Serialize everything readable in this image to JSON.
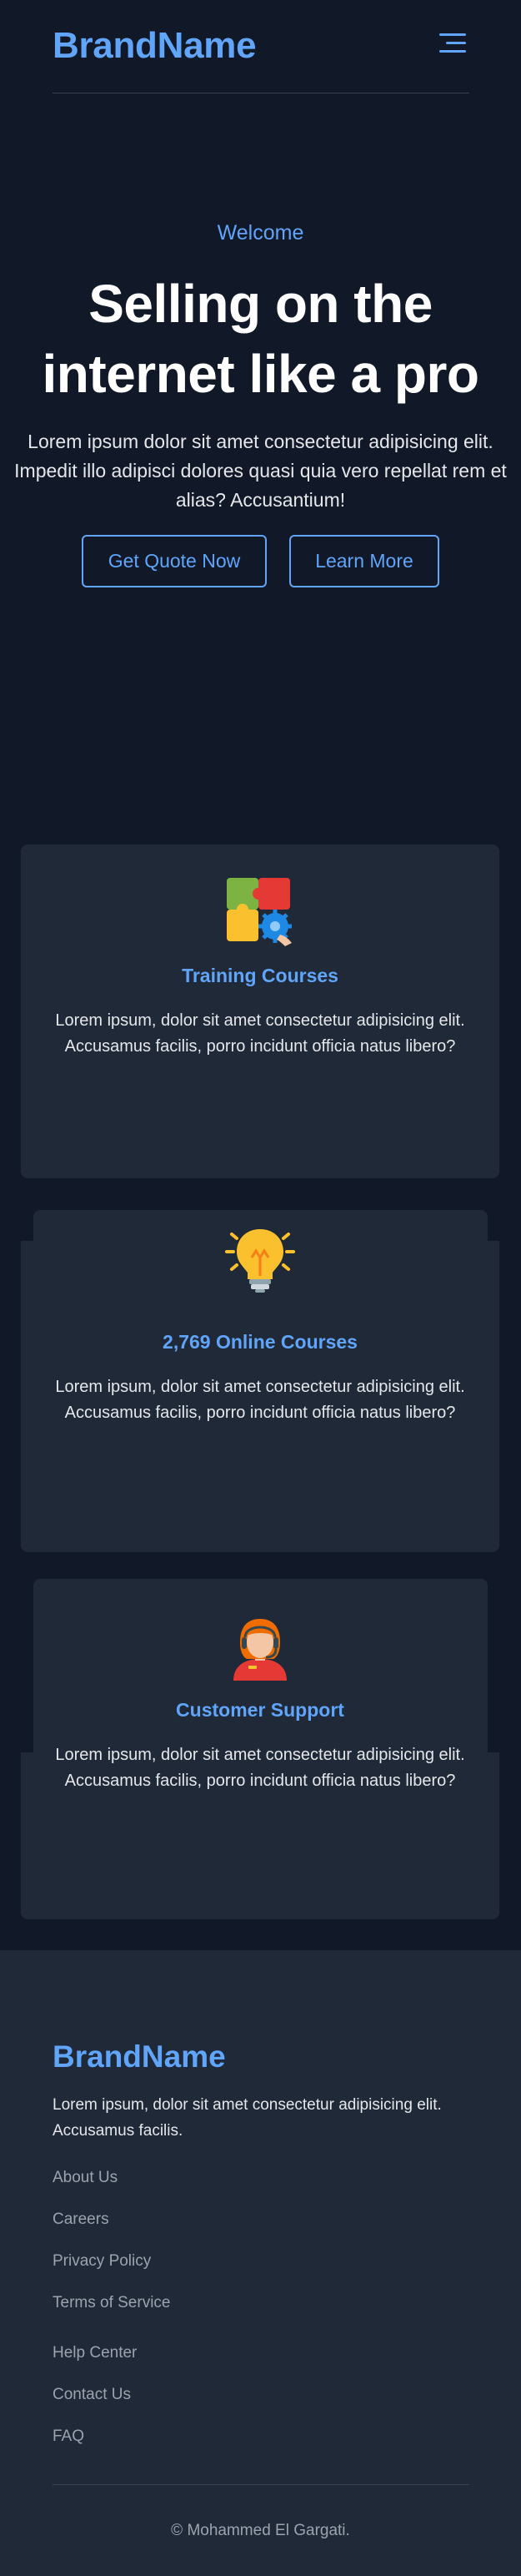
{
  "header": {
    "brand": "BrandName"
  },
  "hero": {
    "eyebrow": "Welcome",
    "title_line1": "Selling on the",
    "title_line2": "internet like a pro",
    "text": "Lorem ipsum dolor sit amet consectetur adipisicing elit. Impedit illo adipisci dolores quasi quia vero repellat rem et alias? Accusantium!",
    "cta_primary": "Get Quote Now",
    "cta_secondary": "Learn More"
  },
  "features": [
    {
      "icon": "puzzle-icon",
      "title": "Training Courses",
      "text": "Lorem ipsum, dolor sit amet consectetur adipisicing elit. Accusamus facilis, porro incidunt officia natus libero?"
    },
    {
      "icon": "lightbulb-icon",
      "title": "2,769 Online Courses",
      "text": "Lorem ipsum, dolor sit amet consectetur adipisicing elit. Accusamus facilis, porro incidunt officia natus libero?"
    },
    {
      "icon": "support-agent-icon",
      "title": "Customer Support",
      "text": "Lorem ipsum, dolor sit amet consectetur adipisicing elit. Accusamus facilis, porro incidunt officia natus libero?"
    }
  ],
  "footer": {
    "brand": "BrandName",
    "text": "Lorem ipsum, dolor sit amet consectetur adipisicing elit. Accusamus facilis.",
    "links": [
      "About Us",
      "Careers",
      "Privacy Policy",
      "Terms of Service",
      "Help Center",
      "Contact Us",
      "FAQ"
    ],
    "copyright": "© Mohammed El Gargati."
  },
  "colors": {
    "background": "#111827",
    "surface": "#1f2937",
    "accent": "#60a5fa"
  }
}
